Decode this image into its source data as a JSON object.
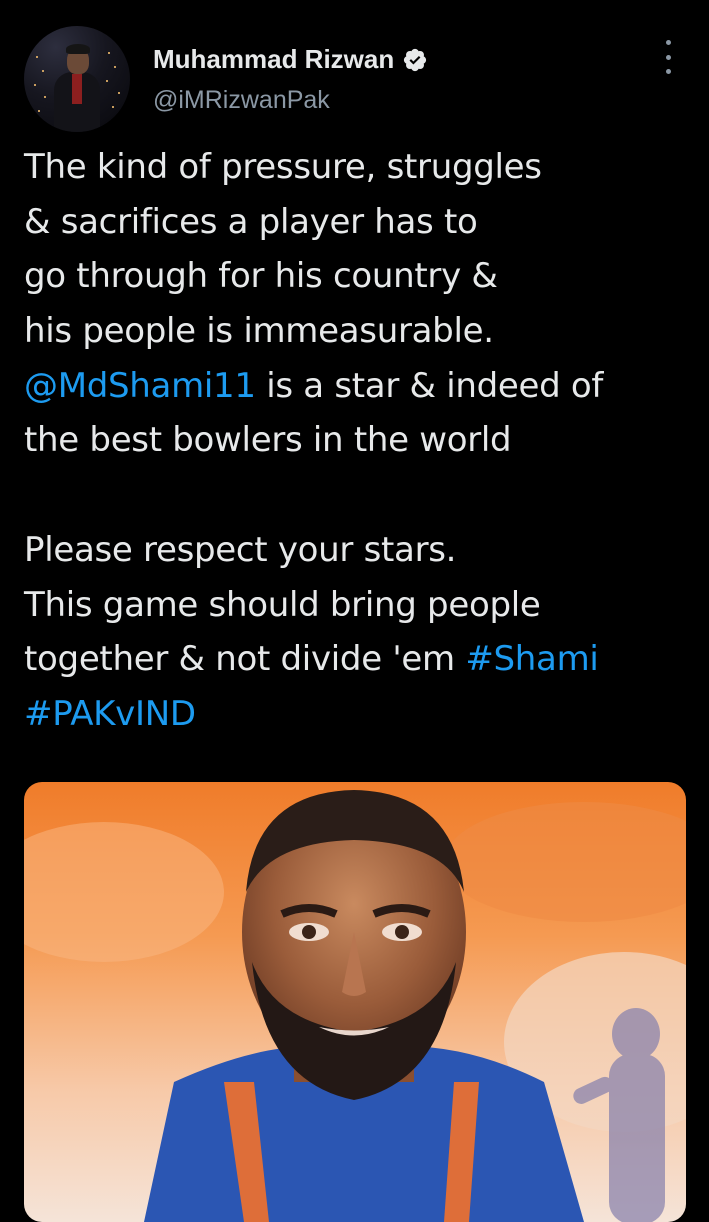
{
  "tweet": {
    "author_name": "Muhammad Rizwan",
    "author_handle": "@iMRizwanPak",
    "verified": true,
    "more_icon": "more-vertical-icon",
    "text_lines": [
      [
        {
          "text": "The kind of pressure, struggles"
        }
      ],
      [
        {
          "text": "& sacrifices a player has to"
        }
      ],
      [
        {
          "text": "go through for his country &"
        }
      ],
      [
        {
          "text": "his people is immeasurable."
        }
      ],
      [
        {
          "text": "@MdShami11",
          "link": true
        },
        {
          "text": " is a star & indeed of"
        }
      ],
      [
        {
          "text": "the best bowlers in the world"
        }
      ],
      [],
      [
        {
          "text": "Please respect your stars."
        }
      ],
      [
        {
          "text": "This game should bring people"
        }
      ],
      [
        {
          "text": "together & not divide 'em "
        },
        {
          "text": "#Shami",
          "link": true
        }
      ],
      [
        {
          "text": "#PAKvIND",
          "link": true
        }
      ]
    ],
    "media": {
      "description_icon": "painted-portrait-image"
    }
  },
  "colors": {
    "background": "#000000",
    "text": "#e7e9ea",
    "secondary_text": "#8b98a5",
    "link": "#1d9bf0",
    "verified_badge": "#e7e9ea"
  }
}
